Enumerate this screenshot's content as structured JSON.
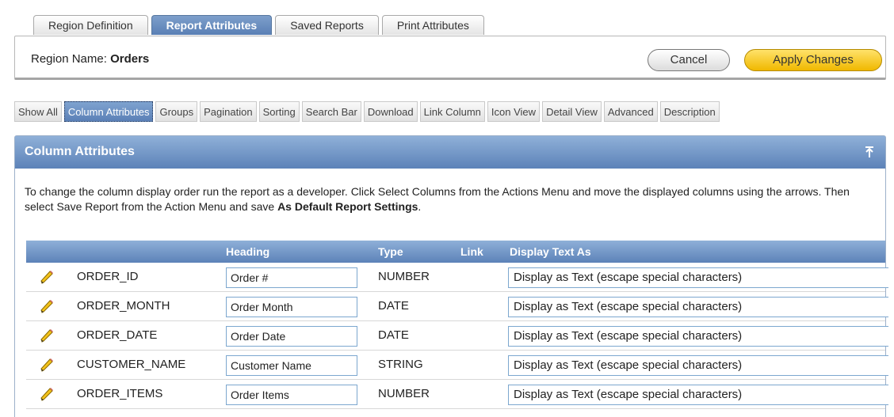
{
  "tabs": [
    {
      "label": "Region Definition",
      "active": false
    },
    {
      "label": "Report Attributes",
      "active": true
    },
    {
      "label": "Saved Reports",
      "active": false
    },
    {
      "label": "Print Attributes",
      "active": false
    }
  ],
  "region": {
    "label": "Region Name:",
    "value": "Orders",
    "cancel_label": "Cancel",
    "apply_label": "Apply Changes"
  },
  "subnav": [
    {
      "label": "Show All",
      "active": false
    },
    {
      "label": "Column Attributes",
      "active": true
    },
    {
      "label": "Groups",
      "active": false
    },
    {
      "label": "Pagination",
      "active": false
    },
    {
      "label": "Sorting",
      "active": false
    },
    {
      "label": "Search Bar",
      "active": false
    },
    {
      "label": "Download",
      "active": false
    },
    {
      "label": "Link Column",
      "active": false
    },
    {
      "label": "Icon View",
      "active": false
    },
    {
      "label": "Detail View",
      "active": false
    },
    {
      "label": "Advanced",
      "active": false
    },
    {
      "label": "Description",
      "active": false
    }
  ],
  "panel": {
    "title": "Column Attributes",
    "description_text": "To change the column display order run the report as a developer. Click Select Columns from the Actions Menu and move the displayed columns using the arrows. Then select Save Report from the Action Menu and save ",
    "description_bold": "As Default Report Settings",
    "description_end": "."
  },
  "table": {
    "headers": {
      "heading": "Heading",
      "type": "Type",
      "link": "Link",
      "display": "Display Text As"
    },
    "rows": [
      {
        "column": "ORDER_ID",
        "heading": "Order #",
        "type": "NUMBER",
        "display": "Display as Text (escape special characters)"
      },
      {
        "column": "ORDER_MONTH",
        "heading": "Order Month",
        "type": "DATE",
        "display": "Display as Text (escape special characters)"
      },
      {
        "column": "ORDER_DATE",
        "heading": "Order Date",
        "type": "DATE",
        "display": "Display as Text (escape special characters)"
      },
      {
        "column": "CUSTOMER_NAME",
        "heading": "Customer Name",
        "type": "STRING",
        "display": "Display as Text (escape special characters)"
      },
      {
        "column": "ORDER_ITEMS",
        "heading": "Order Items",
        "type": "NUMBER",
        "display": "Display as Text (escape special characters)"
      }
    ]
  },
  "colors": {
    "tab_active": "#6a8fc2",
    "apply_button": "#f7c800",
    "header_blue": "#7399cc"
  },
  "icons": {
    "edit": "pencil-icon",
    "collapse": "arrow-top-icon"
  }
}
